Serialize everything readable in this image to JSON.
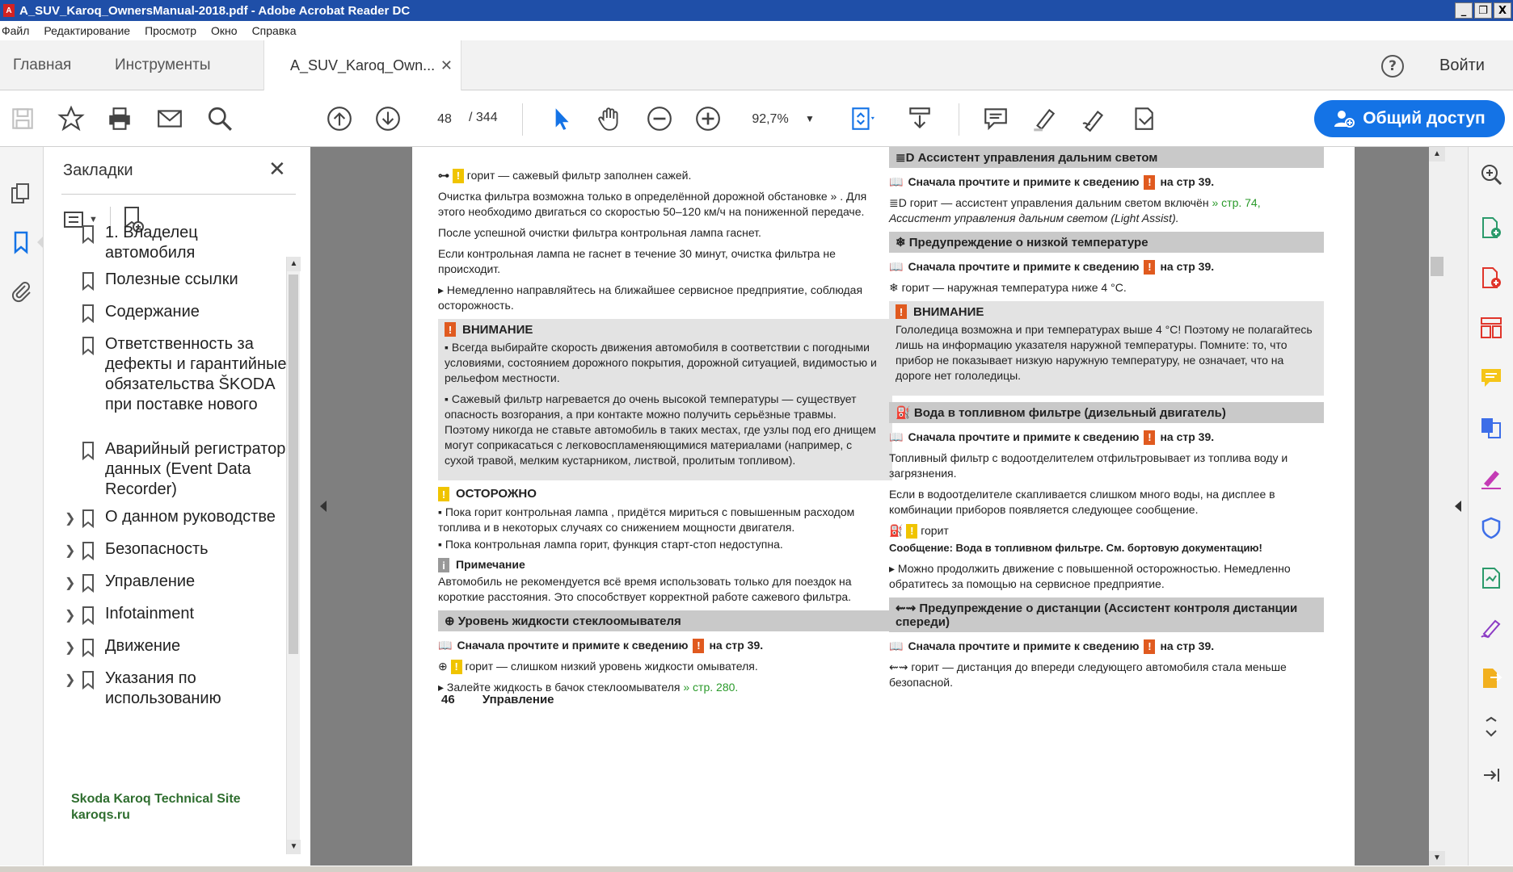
{
  "window": {
    "title": "A_SUV_Karoq_OwnersManual-2018.pdf - Adobe Acrobat Reader DC",
    "controls": [
      "_",
      "❐",
      "X"
    ]
  },
  "menu": [
    "Файл",
    "Редактирование",
    "Просмотр",
    "Окно",
    "Справка"
  ],
  "tabs": {
    "home": "Главная",
    "tools": "Инструменты",
    "document": "A_SUV_Karoq_Own...",
    "signin": "Войти"
  },
  "toolbar": {
    "page_current": "48",
    "page_total": "/ 344",
    "zoom": "92,7%",
    "share_label": "Общий доступ"
  },
  "bookmarks": {
    "title": "Закладки",
    "items": [
      {
        "label": "1. Владелец автомобиля",
        "expandable": false
      },
      {
        "label": "Полезные ссылки",
        "expandable": false
      },
      {
        "label": "Содержание",
        "expandable": false
      },
      {
        "label": "Ответственность за дефекты и гарантийные обязательства ŠKODA при поставке нового",
        "expandable": false
      },
      {
        "label": "Аварийный регистратор данных (Event Data Recorder)",
        "expandable": false
      },
      {
        "label": "О данном руководстве",
        "expandable": true
      },
      {
        "label": "Безопасность",
        "expandable": true
      },
      {
        "label": "Управление",
        "expandable": true
      },
      {
        "label": "Infotainment",
        "expandable": true
      },
      {
        "label": "Движение",
        "expandable": true
      },
      {
        "label": "Указания по использованию",
        "expandable": true
      }
    ],
    "watermark_line1": "Skoda Karoq Technical Site",
    "watermark_line2": "karoqs.ru"
  },
  "document": {
    "left": {
      "p1": "горит — сажевый фильтр заполнен сажей.",
      "p2": "Очистка фильтра возможна только в определённой дорожной обстановке » . Для этого необходимо двигаться со скоростью 50–120 км/ч на пониженной передаче.",
      "p3": "После успешной очистки фильтра контрольная лампа гаснет.",
      "p4": "Если контрольная лампа не гаснет в течение 30 минут, очистка фильтра не происходит.",
      "p5": "Немедленно направляйтесь на ближайшее сервисное предприятие, соблюдая осторожность.",
      "warn_title": "ВНИМАНИЕ",
      "warn_1": "Всегда выбирайте скорость движения автомобиля в соответствии с погодными условиями, состоянием дорожного покрытия, дорожной ситуацией, видимостью и рельефом местности.",
      "warn_2": "Сажевый фильтр нагревается до очень высокой температуры — существует опасность возгорания, а при контакте можно получить серьёзные травмы. Поэтому никогда не ставьте автомобиль в таких местах, где узлы под его днищем могут соприкасаться с легковоспламеняющимися материалами (например, с сухой травой, мелким кустарником, листвой, пролитым топливом).",
      "caution_title": "ОСТОРОЖНО",
      "caution_1": "Пока горит контрольная лампа , придётся мириться с повышенным расходом топлива и в некоторых случаях со снижением мощности двигателя.",
      "caution_2": "Пока контрольная лампа горит, функция старт-стоп недоступна.",
      "note_title": "Примечание",
      "note_text": "Автомобиль не рекомендуется всё время использовать только для поездок на короткие расстояния. Это способствует корректной работе сажевого фильтра.",
      "washer_title": "Уровень жидкости стеклоомывателя",
      "read_first": "Сначала прочтите и примите к сведению",
      "page_ref": "на стр 39.",
      "washer_p1": "горит — слишком низкий уровень жидкости омывателя.",
      "washer_p2": "Залейте жидкость в бачок стеклоомывателя",
      "washer_link": "» стр. 280.",
      "footer_page": "46",
      "footer_section": "Управление"
    },
    "right": {
      "highbeam_title": "Ассистент управления дальним светом",
      "read_first": "Сначала прочтите и примите к сведению",
      "page_ref": "на стр 39.",
      "highbeam_p1": "горит — ассистент управления дальним светом включён",
      "highbeam_link": "» стр. 74,",
      "highbeam_p1_tail": "Ассистент управления дальним светом (Light Assist).",
      "lowtemp_title": "Предупреждение о низкой температуре",
      "lowtemp_p1": "горит — наружная температура ниже 4 °C.",
      "warn_title": "ВНИМАНИЕ",
      "warn_text": "Гололедица возможна и при температурах выше 4 °C! Поэтому не полагайтесь лишь на информацию указателя наружной температуры. Помните: то, что прибор не показывает низкую наружную температуру, не означает, что на дороге нет гололедицы.",
      "water_title": "Вода в топливном фильтре (дизельный двигатель)",
      "water_p1": "Топливный фильтр с водоотделителем отфильтровывает из топлива воду и загрязнения.",
      "water_p2": "Если в водоотделителе скапливается слишком много воды, на дисплее в комбинации приборов появляется следующее сообщение.",
      "water_p3": "горит",
      "water_msg": "Сообщение: Вода в топливном фильтре. См. бортовую документацию!",
      "water_p4": "Можно продолжить движение с повышенной осторожностью. Немедленно обратитесь за помощью на сервисное предприятие.",
      "distance_title": "Предупреждение о дистанции (Ассистент контроля дистанции спереди)",
      "distance_p1": "горит — дистанция до впереди следующего автомобиля стала меньше безопасной."
    }
  }
}
